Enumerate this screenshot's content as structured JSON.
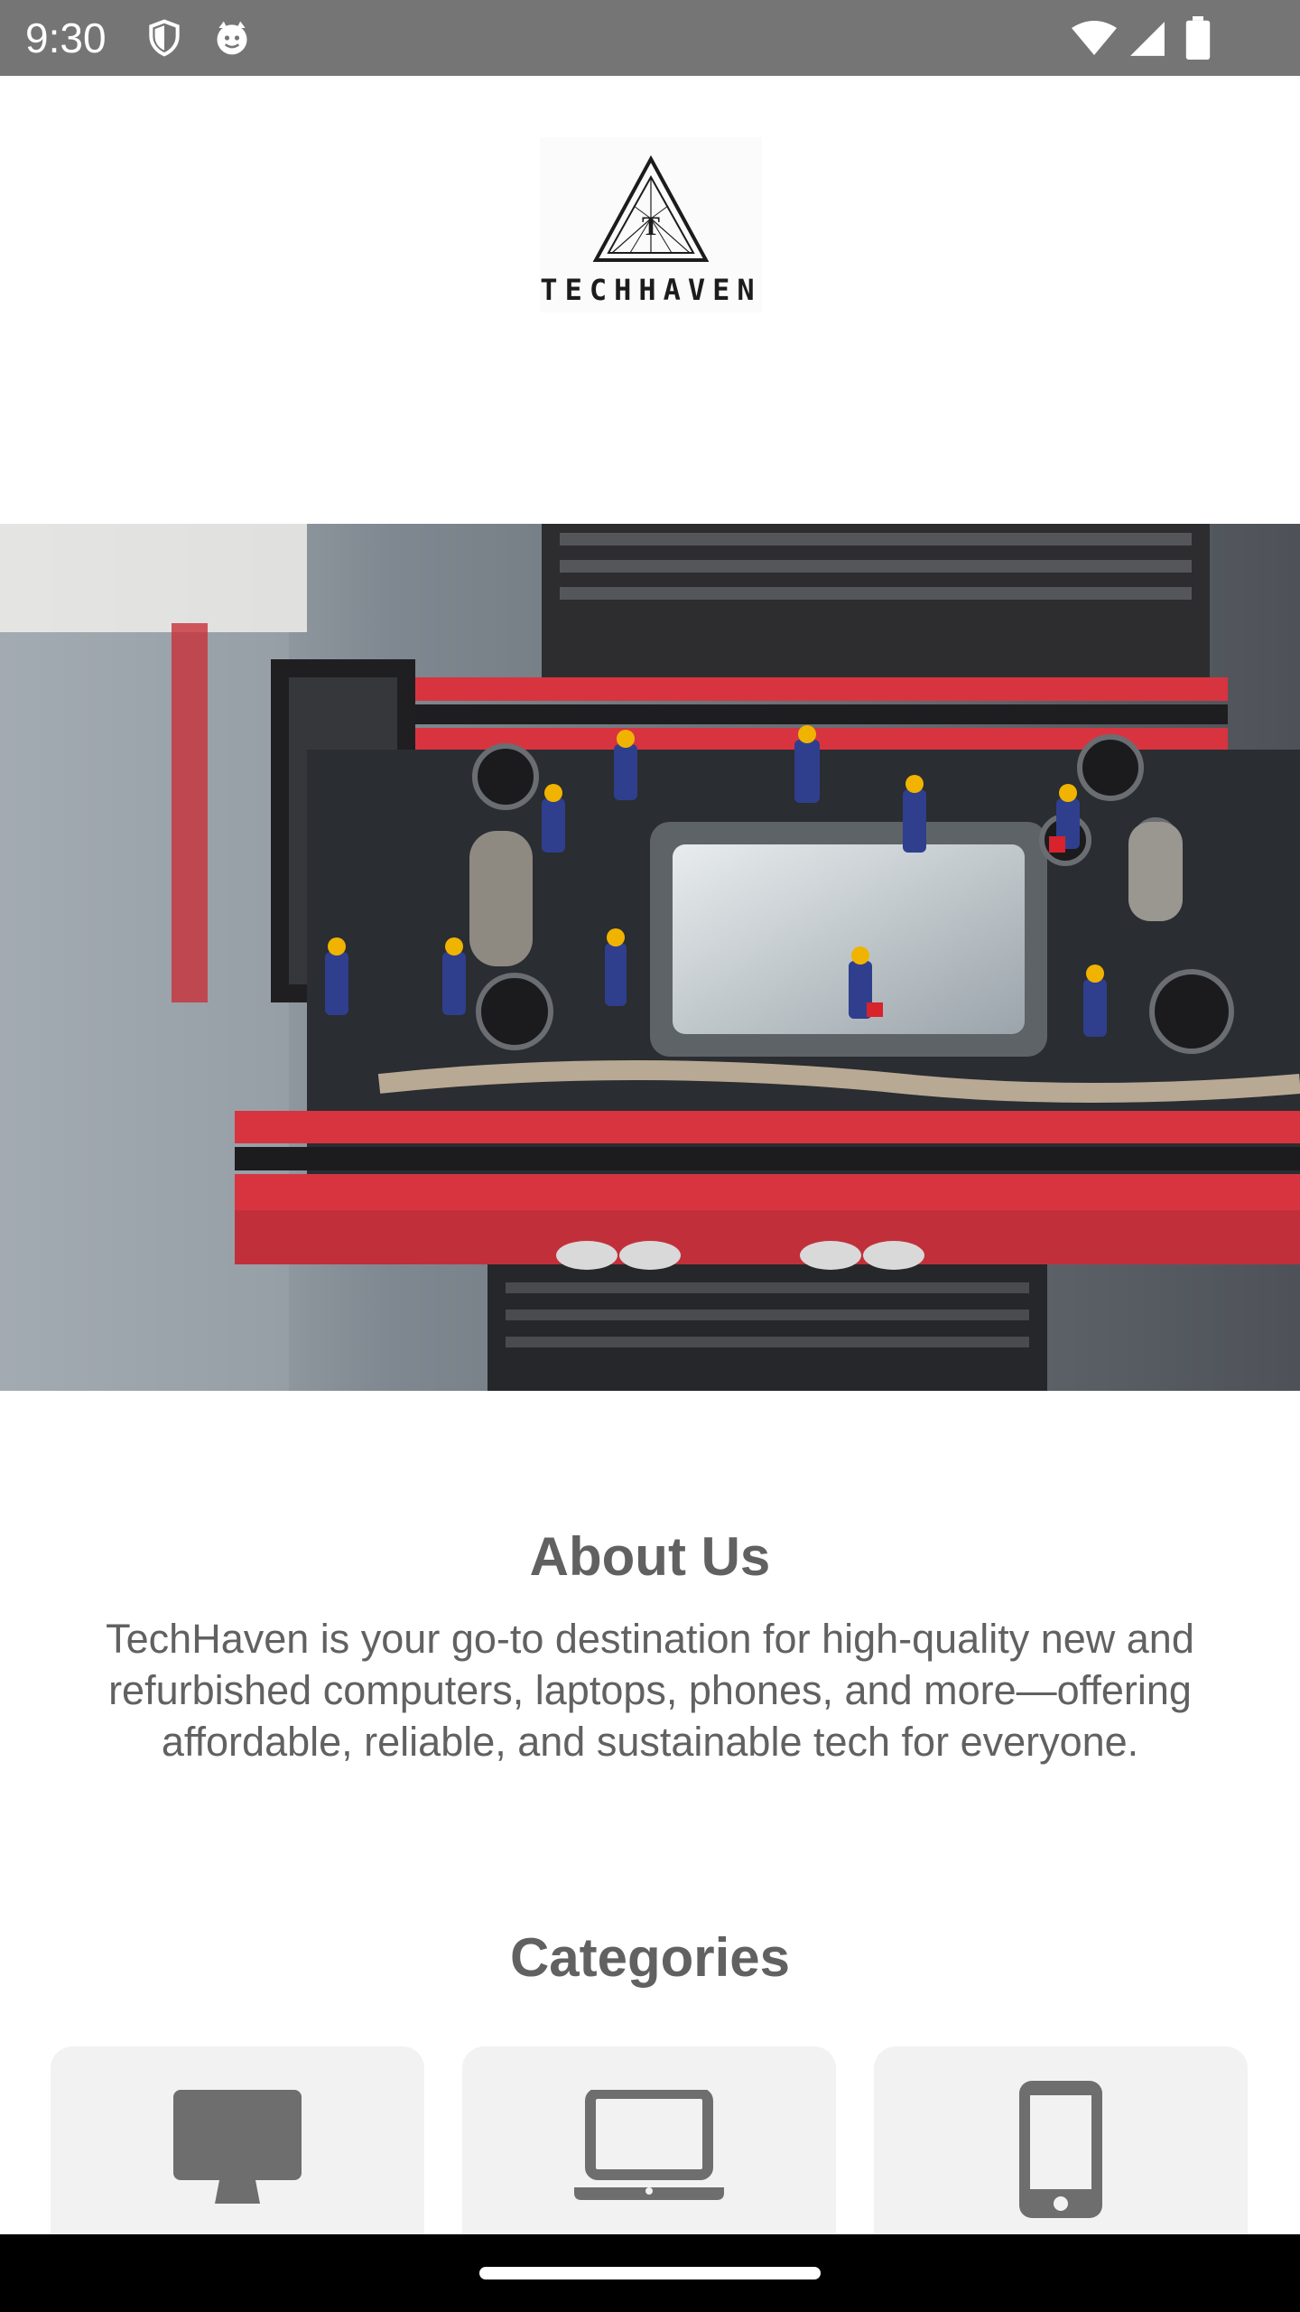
{
  "status_bar": {
    "time": "9:30"
  },
  "logo": {
    "letter": "T",
    "brand": "TECHHAVEN"
  },
  "about": {
    "title": "About Us",
    "text": "TechHaven is your go-to destination for high-quality new and refurbished computers, laptops, phones, and more—offering affordable, reliable, and sustainable tech for everyone."
  },
  "categories": {
    "title": "Categories",
    "items": [
      {
        "icon": "desktop-icon"
      },
      {
        "icon": "laptop-icon"
      },
      {
        "icon": "phone-icon"
      }
    ]
  },
  "colors": {
    "status_bar": "#757575",
    "text": "#616161",
    "card": "#f2f2f2",
    "icon": "#6e6e6e"
  }
}
